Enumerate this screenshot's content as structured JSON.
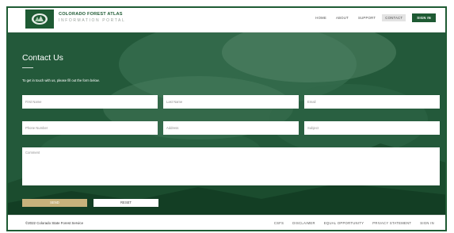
{
  "header": {
    "title": "COLORADO FOREST ATLAS",
    "subtitle": "INFORMATION PORTAL",
    "nav": [
      {
        "label": "HOME"
      },
      {
        "label": "ABOUT"
      },
      {
        "label": "SUPPORT"
      },
      {
        "label": "CONTACT",
        "active": true
      }
    ],
    "sign_in_label": "SIGN IN"
  },
  "contact": {
    "title": "Contact Us",
    "intro": "To get in touch with us, please fill out the form below.",
    "fields": {
      "first_name": {
        "placeholder": "First Name",
        "value": ""
      },
      "last_name": {
        "placeholder": "Last Name",
        "value": ""
      },
      "email": {
        "placeholder": "Email",
        "value": ""
      },
      "phone": {
        "placeholder": "Phone Number",
        "value": ""
      },
      "address": {
        "placeholder": "Address",
        "value": ""
      },
      "subject": {
        "placeholder": "Subject",
        "value": ""
      },
      "comment": {
        "placeholder": "Comment",
        "value": ""
      }
    },
    "send_label": "SEND",
    "reset_label": "RESET"
  },
  "footer": {
    "copyright": "©2022 Colorado State Forest Service",
    "links": [
      "CSFS",
      "DISCLAIMER",
      "EQUAL OPPORTUNITY",
      "PRIVACY STATEMENT",
      "SIGN IN"
    ]
  },
  "colors": {
    "brand_green": "#1e5a33",
    "send_button": "#c8b27c"
  }
}
